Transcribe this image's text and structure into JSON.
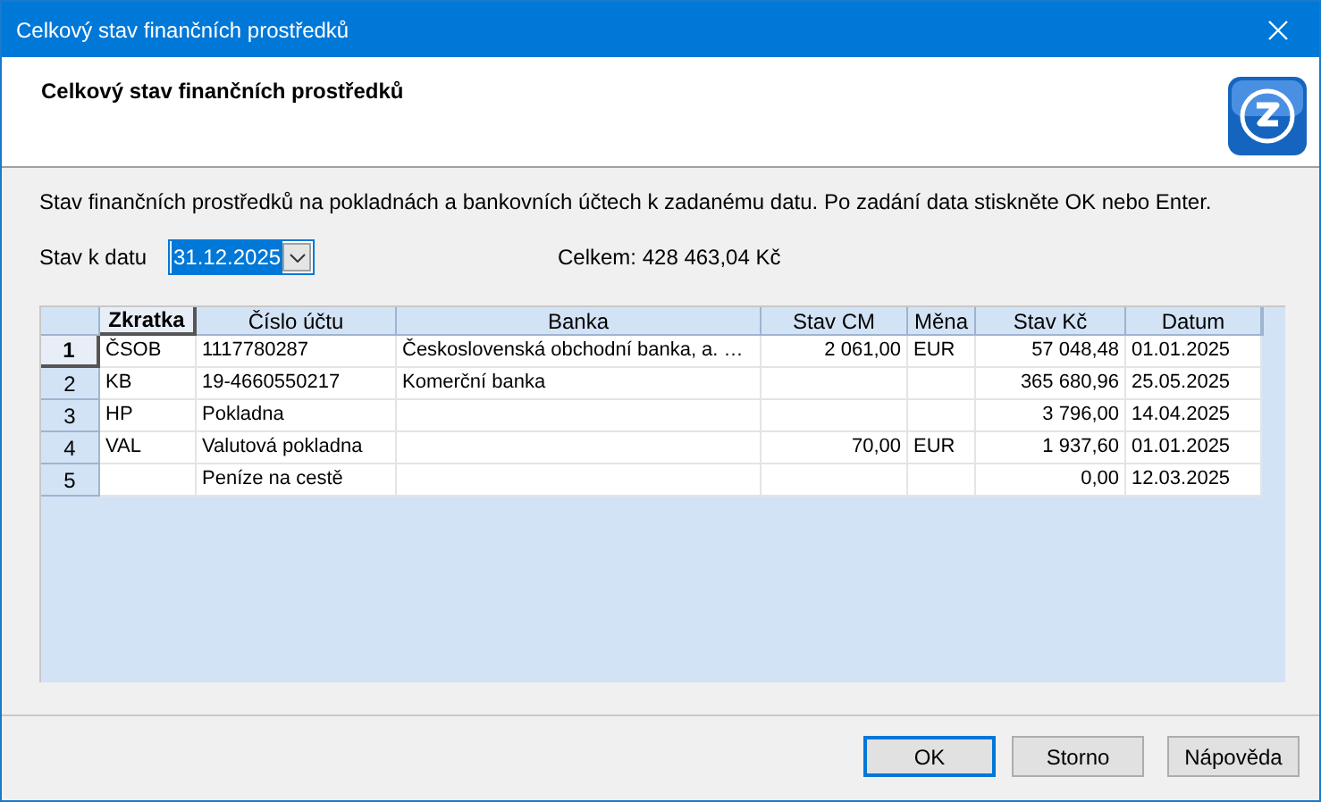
{
  "window": {
    "title": "Celkový stav finančních prostředků"
  },
  "header": {
    "title": "Celkový stav finančních prostředků"
  },
  "description": "Stav finančních prostředků na pokladnách a bankovních účtech k zadanému datu. Po zadání data stiskněte OK nebo Enter.",
  "date_field": {
    "label": "Stav k datu",
    "value": "31.12.2025"
  },
  "total": "Celkem: 428 463,04 Kč",
  "table": {
    "columns": [
      {
        "label": "Zkratka",
        "sorted": true
      },
      {
        "label": "Číslo účtu",
        "sorted": false
      },
      {
        "label": "Banka",
        "sorted": false
      },
      {
        "label": "Stav CM",
        "sorted": false
      },
      {
        "label": "Měna",
        "sorted": false
      },
      {
        "label": "Stav Kč",
        "sorted": false
      },
      {
        "label": "Datum",
        "sorted": false
      }
    ],
    "rows": [
      {
        "number": "1",
        "selected": true,
        "cells": [
          "ČSOB",
          "1117780287",
          "Československá obchodní banka, a. …",
          "2 061,00",
          "EUR",
          "57 048,48",
          "01.01.2025"
        ]
      },
      {
        "number": "2",
        "selected": false,
        "cells": [
          "KB",
          "19-4660550217",
          "Komerční banka",
          "",
          "",
          "365 680,96",
          "25.05.2025"
        ]
      },
      {
        "number": "3",
        "selected": false,
        "cells": [
          "HP",
          "Pokladna",
          "",
          "",
          "",
          "3 796,00",
          "14.04.2025"
        ]
      },
      {
        "number": "4",
        "selected": false,
        "cells": [
          "VAL",
          "Valutová pokladna",
          "",
          "70,00",
          "EUR",
          "1 937,60",
          "01.01.2025"
        ]
      },
      {
        "number": "5",
        "selected": false,
        "cells": [
          "",
          "Peníze na cestě",
          "",
          "",
          "",
          "0,00",
          "12.03.2025"
        ]
      }
    ]
  },
  "buttons": [
    {
      "label": "OK",
      "default": true
    },
    {
      "label": "Storno",
      "default": false
    },
    {
      "label": "Nápověda",
      "default": false
    }
  ]
}
